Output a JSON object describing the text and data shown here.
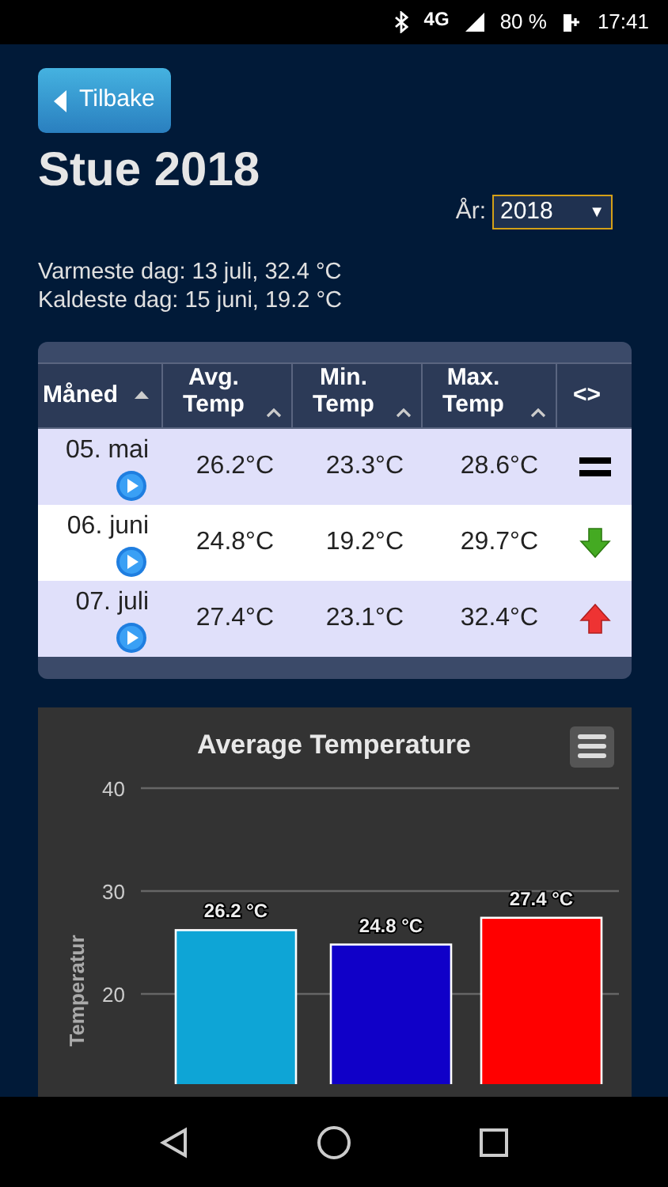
{
  "status_bar": {
    "network": "4G",
    "battery": "80 %",
    "time": "17:41"
  },
  "back_button": {
    "label": "Tilbake"
  },
  "title": "Stue 2018",
  "year_select": {
    "label": "År:",
    "value": "2018",
    "arrow": "▼"
  },
  "summary": [
    "Varmeste dag: 13 juli, 32.4 °C",
    "Kaldeste dag: 15 juni, 19.2 °C"
  ],
  "table": {
    "columns": [
      {
        "label": "Måned",
        "kind": "solid"
      },
      {
        "label": "Avg. Temp",
        "kind": "chevron"
      },
      {
        "label": "Min. Temp",
        "kind": "chevron"
      },
      {
        "label": "Max. Temp",
        "kind": "chevron"
      },
      {
        "label": "<>",
        "kind": "plain"
      }
    ],
    "rows": [
      {
        "month": "05. mai",
        "avg": "26.2°C",
        "min": "23.3°C",
        "max": "28.6°C",
        "kind": "equal",
        "selected": false
      },
      {
        "month": "06. juni",
        "avg": "24.8°C",
        "min": "19.2°C",
        "max": "29.7°C",
        "kind": "down",
        "selected": true
      },
      {
        "month": "07. juli",
        "avg": "27.4°C",
        "min": "23.1°C",
        "max": "32.4°C",
        "kind": "up",
        "selected": false
      }
    ]
  },
  "chart": {
    "chart_data": {
      "type": "bar",
      "title": "Average Temperature",
      "ylabel": "Temperatur",
      "values": [
        26.2,
        24.8,
        27.4
      ],
      "colors": [
        "#0ea5d6",
        "#1000c8",
        "#ff0000"
      ],
      "yticks": [
        20,
        30,
        40
      ],
      "ylim": [
        0,
        40
      ],
      "data_labels": true,
      "value_labels": [
        "26.2 °C",
        "24.8 °C",
        "27.4 °C"
      ]
    }
  }
}
